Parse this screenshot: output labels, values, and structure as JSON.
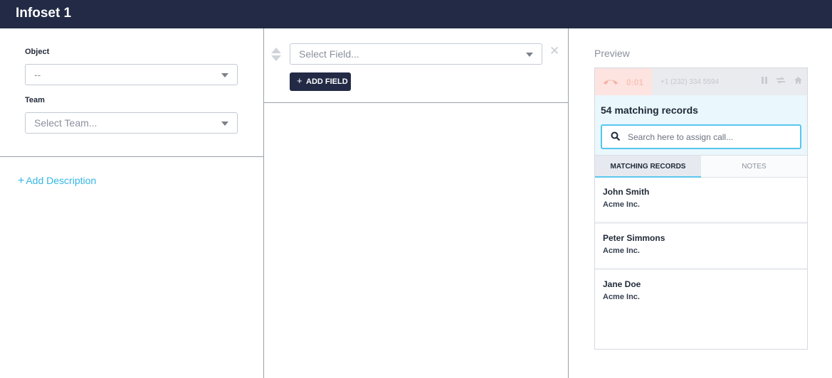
{
  "app": {
    "title": "Infoset 1"
  },
  "left_panel": {
    "object_label": "Object",
    "object_value": "--",
    "team_label": "Team",
    "team_placeholder": "Select Team...",
    "add_description": "Add Description",
    "add_description_icon": "plus-icon"
  },
  "middle_panel": {
    "field_placeholder": "Select Field...",
    "add_field_label": "ADD FIELD",
    "remove_icon": "close-icon",
    "reorder_icon": "sort-handle-icon"
  },
  "preview": {
    "label": "Preview",
    "call": {
      "timer": "0:01",
      "number": "+1 (232) 334 5594",
      "icons": [
        "phone-hangup-icon",
        "pause-icon",
        "transfer-icon",
        "home-icon"
      ]
    },
    "matching_title": "54 matching records",
    "search_placeholder": "Search here to assign call...",
    "tabs": [
      {
        "label": "MATCHING RECORDS",
        "active": true
      },
      {
        "label": "NOTES",
        "active": false
      }
    ],
    "records": [
      {
        "name": "John Smith",
        "company": "Acme Inc."
      },
      {
        "name": "Peter Simmons",
        "company": "Acme Inc."
      },
      {
        "name": "Jane Doe",
        "company": "Acme Inc."
      }
    ]
  },
  "colors": {
    "topbar": "#222a45",
    "accent": "#34b6e4",
    "search_border": "#56c6ef",
    "call_red": "#fde4e0"
  }
}
